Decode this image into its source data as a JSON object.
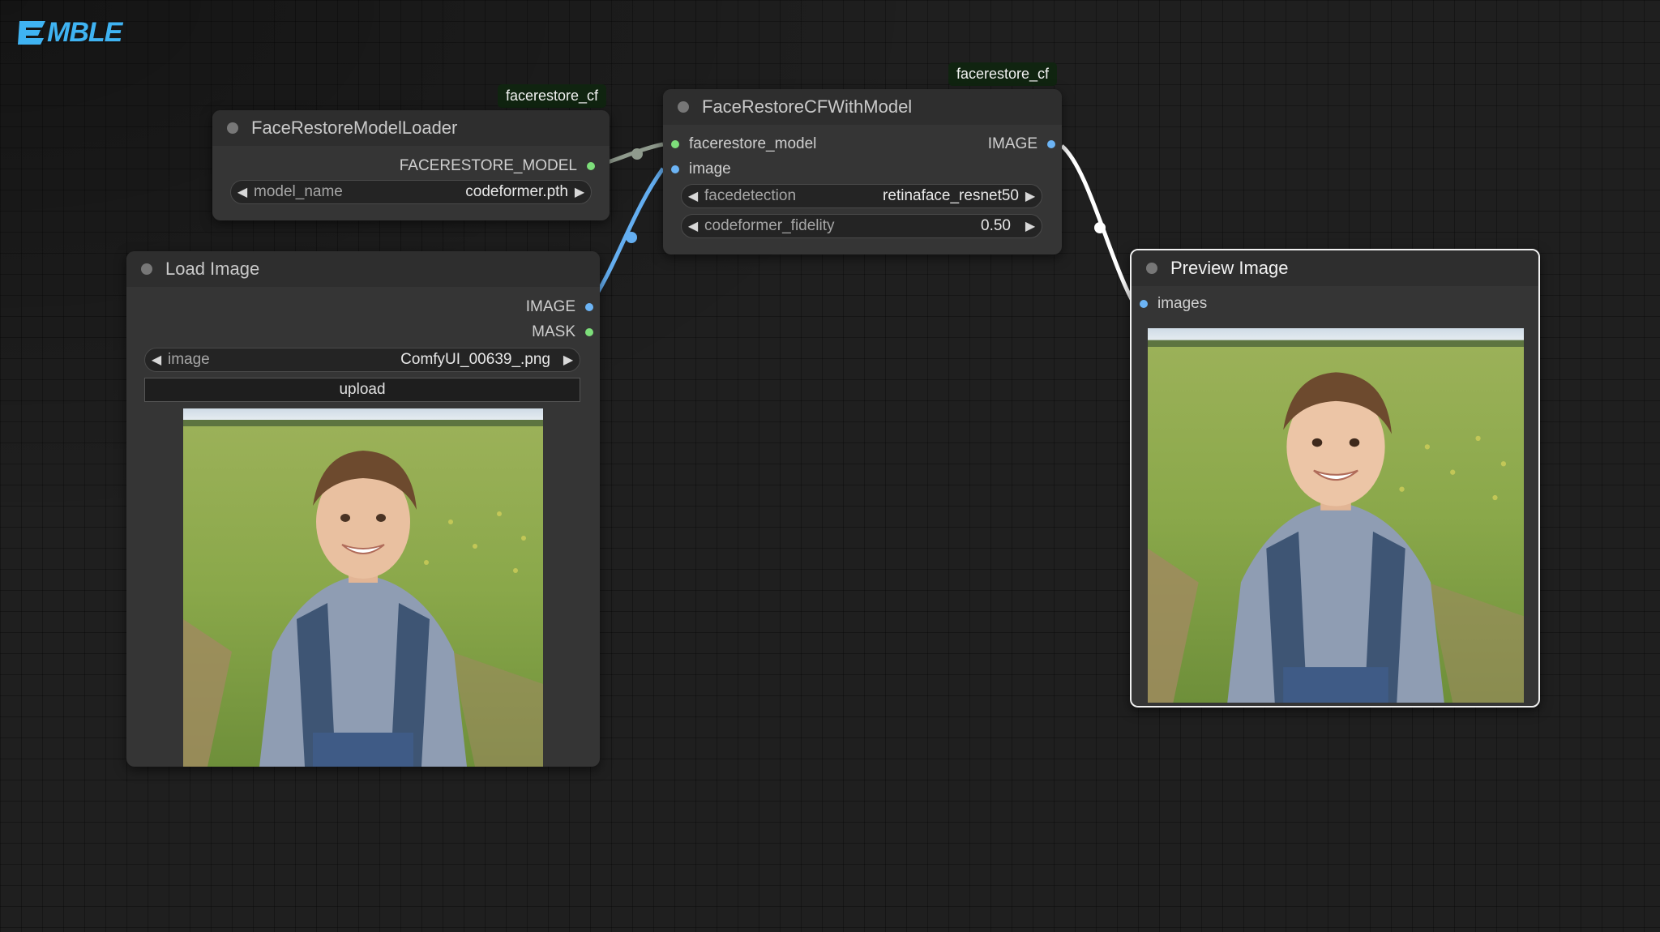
{
  "logo": {
    "text": "MBLE"
  },
  "nodes": {
    "loader": {
      "title": "FaceRestoreModelLoader",
      "badge": "facerestore_cf",
      "outputs": [
        "FACERESTORE_MODEL"
      ],
      "widgets": [
        {
          "label": "model_name",
          "value": "codeformer.pth"
        }
      ]
    },
    "restore": {
      "title": "FaceRestoreCFWithModel",
      "badge": "facerestore_cf",
      "inputs": [
        "facerestore_model",
        "image"
      ],
      "outputs": [
        "IMAGE"
      ],
      "widgets": [
        {
          "label": "facedetection",
          "value": "retinaface_resnet50"
        },
        {
          "label": "codeformer_fidelity",
          "value": "0.50"
        }
      ]
    },
    "load_image": {
      "title": "Load Image",
      "outputs": [
        "IMAGE",
        "MASK"
      ],
      "widgets": [
        {
          "label": "image",
          "value": "ComfyUI_00639_.png"
        }
      ],
      "upload_label": "upload"
    },
    "preview": {
      "title": "Preview Image",
      "inputs": [
        "images"
      ]
    }
  },
  "colors": {
    "model_wire": "#8f9a8d",
    "image_wire": "#64aef0",
    "selected_wire": "#ffffff",
    "badge_bg": "#102410"
  },
  "icons": {
    "arrow_left": "◀",
    "arrow_right": "▶"
  }
}
